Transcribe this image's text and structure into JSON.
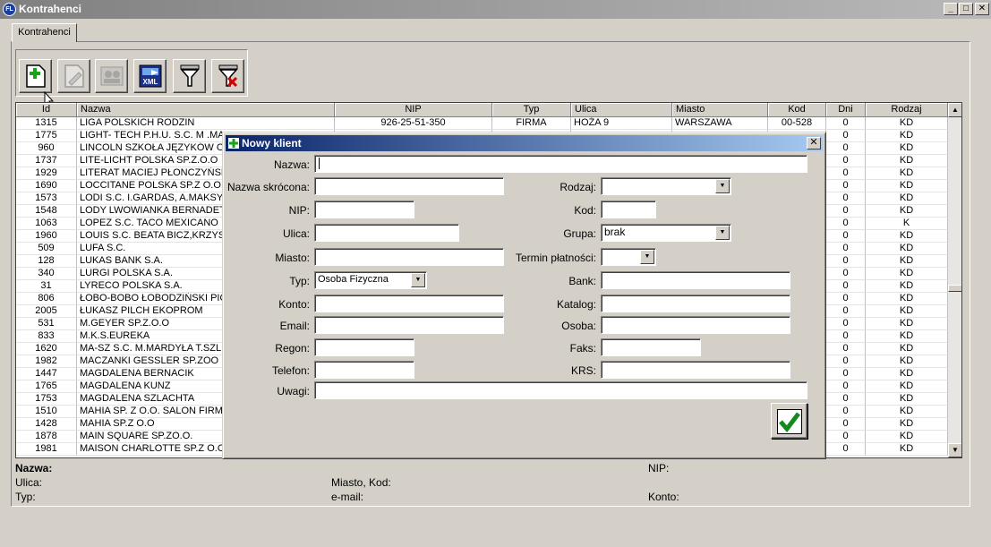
{
  "window": {
    "title": "Kontrahenci",
    "app_icon": "FL",
    "controls": {
      "minimize": "_",
      "maximize": "□",
      "close": "✕"
    }
  },
  "tab": {
    "label": "Kontrahenci"
  },
  "toolbar": {
    "buttons": [
      {
        "name": "new-icon",
        "enabled": true
      },
      {
        "name": "edit-icon",
        "enabled": false
      },
      {
        "name": "contacts-icon",
        "enabled": false
      },
      {
        "name": "export-xml-icon",
        "enabled": true,
        "text": "XML"
      },
      {
        "name": "filter-icon",
        "enabled": true
      },
      {
        "name": "clear-filter-icon",
        "enabled": true
      }
    ]
  },
  "grid": {
    "columns": [
      "Id",
      "Nazwa",
      "NIP",
      "Typ",
      "Ulica",
      "Miasto",
      "Kod",
      "Dni",
      "Rodzaj"
    ],
    "rows": [
      [
        "1315",
        "LIGA POLSKICH RODZIN",
        "926-25-51-350",
        "FIRMA",
        "HOŻA 9",
        "WARSZAWA",
        "00-528",
        "0",
        "KD"
      ],
      [
        "1775",
        "LIGHT- TECH  P.H.U. S.C. M .MA",
        "",
        "",
        "",
        "",
        "",
        "0",
        "KD"
      ],
      [
        "960",
        "LINCOLN SZKOŁA JĘZYKÓW OBC",
        "",
        "",
        "",
        "",
        "",
        "0",
        "KD"
      ],
      [
        "1737",
        "LITE-LICHT POLSKA SP.Z.O.O",
        "",
        "",
        "",
        "",
        "",
        "0",
        "KD"
      ],
      [
        "1929",
        "LITERAT MACIEJ PŁONCZYŃSKI",
        "",
        "",
        "",
        "",
        "",
        "0",
        "KD"
      ],
      [
        "1690",
        "LOCCITANE POLSKA SP.Z O.O. F",
        "",
        "",
        "",
        "",
        "",
        "0",
        "KD"
      ],
      [
        "1573",
        "LODI S.C. I.GARDAS, A.MAKSYM",
        "",
        "",
        "",
        "",
        "",
        "0",
        "KD"
      ],
      [
        "1548",
        "LODY LWOWIANKA BERNADETA",
        "",
        "",
        "",
        "",
        "",
        "0",
        "KD"
      ],
      [
        "1063",
        "LOPEZ S.C.   TACO MEXICANO",
        "",
        "",
        "",
        "",
        "",
        "0",
        "K"
      ],
      [
        "1960",
        "LOUIS S.C. BEATA BICZ,KRZYSZ",
        "",
        "",
        "",
        "",
        "",
        "0",
        "KD"
      ],
      [
        "509",
        "LUFA S.C.",
        "",
        "",
        "",
        "",
        "",
        "0",
        "KD"
      ],
      [
        "128",
        "LUKAS BANK S.A.",
        "",
        "",
        "",
        "",
        "",
        "0",
        "KD"
      ],
      [
        "340",
        "LURGI POLSKA S.A.",
        "",
        "",
        "",
        "",
        "",
        "0",
        "KD"
      ],
      [
        "31",
        "LYRECO POLSKA S.A.",
        "",
        "",
        "",
        "",
        "",
        "0",
        "KD"
      ],
      [
        "806",
        "ŁOBO-BOBO ŁOBODZIŃSKI PIOT",
        "",
        "",
        "",
        "",
        "",
        "0",
        "KD"
      ],
      [
        "2005",
        "ŁUKASZ PILCH EKOPROM",
        "",
        "",
        "",
        "",
        "",
        "0",
        "KD"
      ],
      [
        "531",
        "M.GEYER SP.Z.O.O",
        "",
        "",
        "",
        "",
        "",
        "0",
        "KD"
      ],
      [
        "833",
        "M.K.S.EUREKA",
        "",
        "",
        "",
        "",
        "",
        "0",
        "KD"
      ],
      [
        "1620",
        "MA-SZ S.C. M.MARDYŁA  T.SZLE",
        "",
        "",
        "",
        "",
        "",
        "0",
        "KD"
      ],
      [
        "1982",
        "MACZANKI GESSLER SP.ZOO",
        "",
        "",
        "",
        "",
        "",
        "0",
        "KD"
      ],
      [
        "1447",
        "MAGDALENA BERNACIK",
        "",
        "",
        "",
        "",
        "",
        "0",
        "KD"
      ],
      [
        "1765",
        "MAGDALENA KUNZ",
        "",
        "",
        "",
        "",
        "",
        "0",
        "KD"
      ],
      [
        "1753",
        "MAGDALENA SZLACHTA",
        "",
        "",
        "",
        "",
        "",
        "0",
        "KD"
      ],
      [
        "1510",
        "MAHIA SP. Z O.O. SALON FIRMC",
        "",
        "",
        "",
        "",
        "",
        "0",
        "KD"
      ],
      [
        "1428",
        "MAHIA SP.Z O.O",
        "",
        "",
        "",
        "",
        "",
        "0",
        "KD"
      ],
      [
        "1878",
        "MAIN SQUARE  SP.ZO.O.",
        "",
        "",
        "",
        "",
        "",
        "0",
        "KD"
      ],
      [
        "1981",
        "MAISON CHARLOTTE SP.Z O.O.",
        "",
        "",
        "",
        "",
        "",
        "0",
        "KD"
      ]
    ],
    "scroll_up": "▲",
    "scroll_down": "▼"
  },
  "details": {
    "nazwa": "Nazwa:",
    "nip": "NIP:",
    "ulica": "Ulica:",
    "miasto_kod": "Miasto, Kod:",
    "typ": "Typ:",
    "email": "e-mail:",
    "konto": "Konto:"
  },
  "dialog": {
    "title": "Nowy klient",
    "close": "✕",
    "labels": {
      "nazwa": "Nazwa:",
      "nazwa_skrocona": "Nazwa skrócona:",
      "nip": "NIP:",
      "ulica": "Ulica:",
      "miasto": "Miasto:",
      "typ": "Typ:",
      "konto": "Konto:",
      "email": "Email:",
      "regon": "Regon:",
      "telefon": "Telefon:",
      "uwagi": "Uwagi:",
      "rodzaj": "Rodzaj:",
      "kod": "Kod:",
      "grupa": "Grupa:",
      "termin": "Termin płatności:",
      "bank": "Bank:",
      "katalog": "Katalog:",
      "osoba": "Osoba:",
      "faks": "Faks:",
      "krs": "KRS:"
    },
    "values": {
      "nazwa": "",
      "nazwa_skrocona": "",
      "nip": "",
      "ulica": "",
      "miasto": "",
      "typ": "Osoba Fizyczna",
      "konto": "",
      "email": "",
      "regon": "",
      "telefon": "",
      "uwagi": "",
      "rodzaj": "",
      "kod": "",
      "grupa": "brak",
      "termin": "",
      "bank": "",
      "katalog": "",
      "osoba": "",
      "faks": "",
      "krs": ""
    },
    "dropdown_arrow": "▼"
  },
  "colors": {
    "dialog_title_start": "#0a246a",
    "dialog_title_end": "#a6caf0",
    "ok_check": "#138a1c",
    "new_plus": "#1aa31a",
    "clear_x": "#d40000"
  }
}
